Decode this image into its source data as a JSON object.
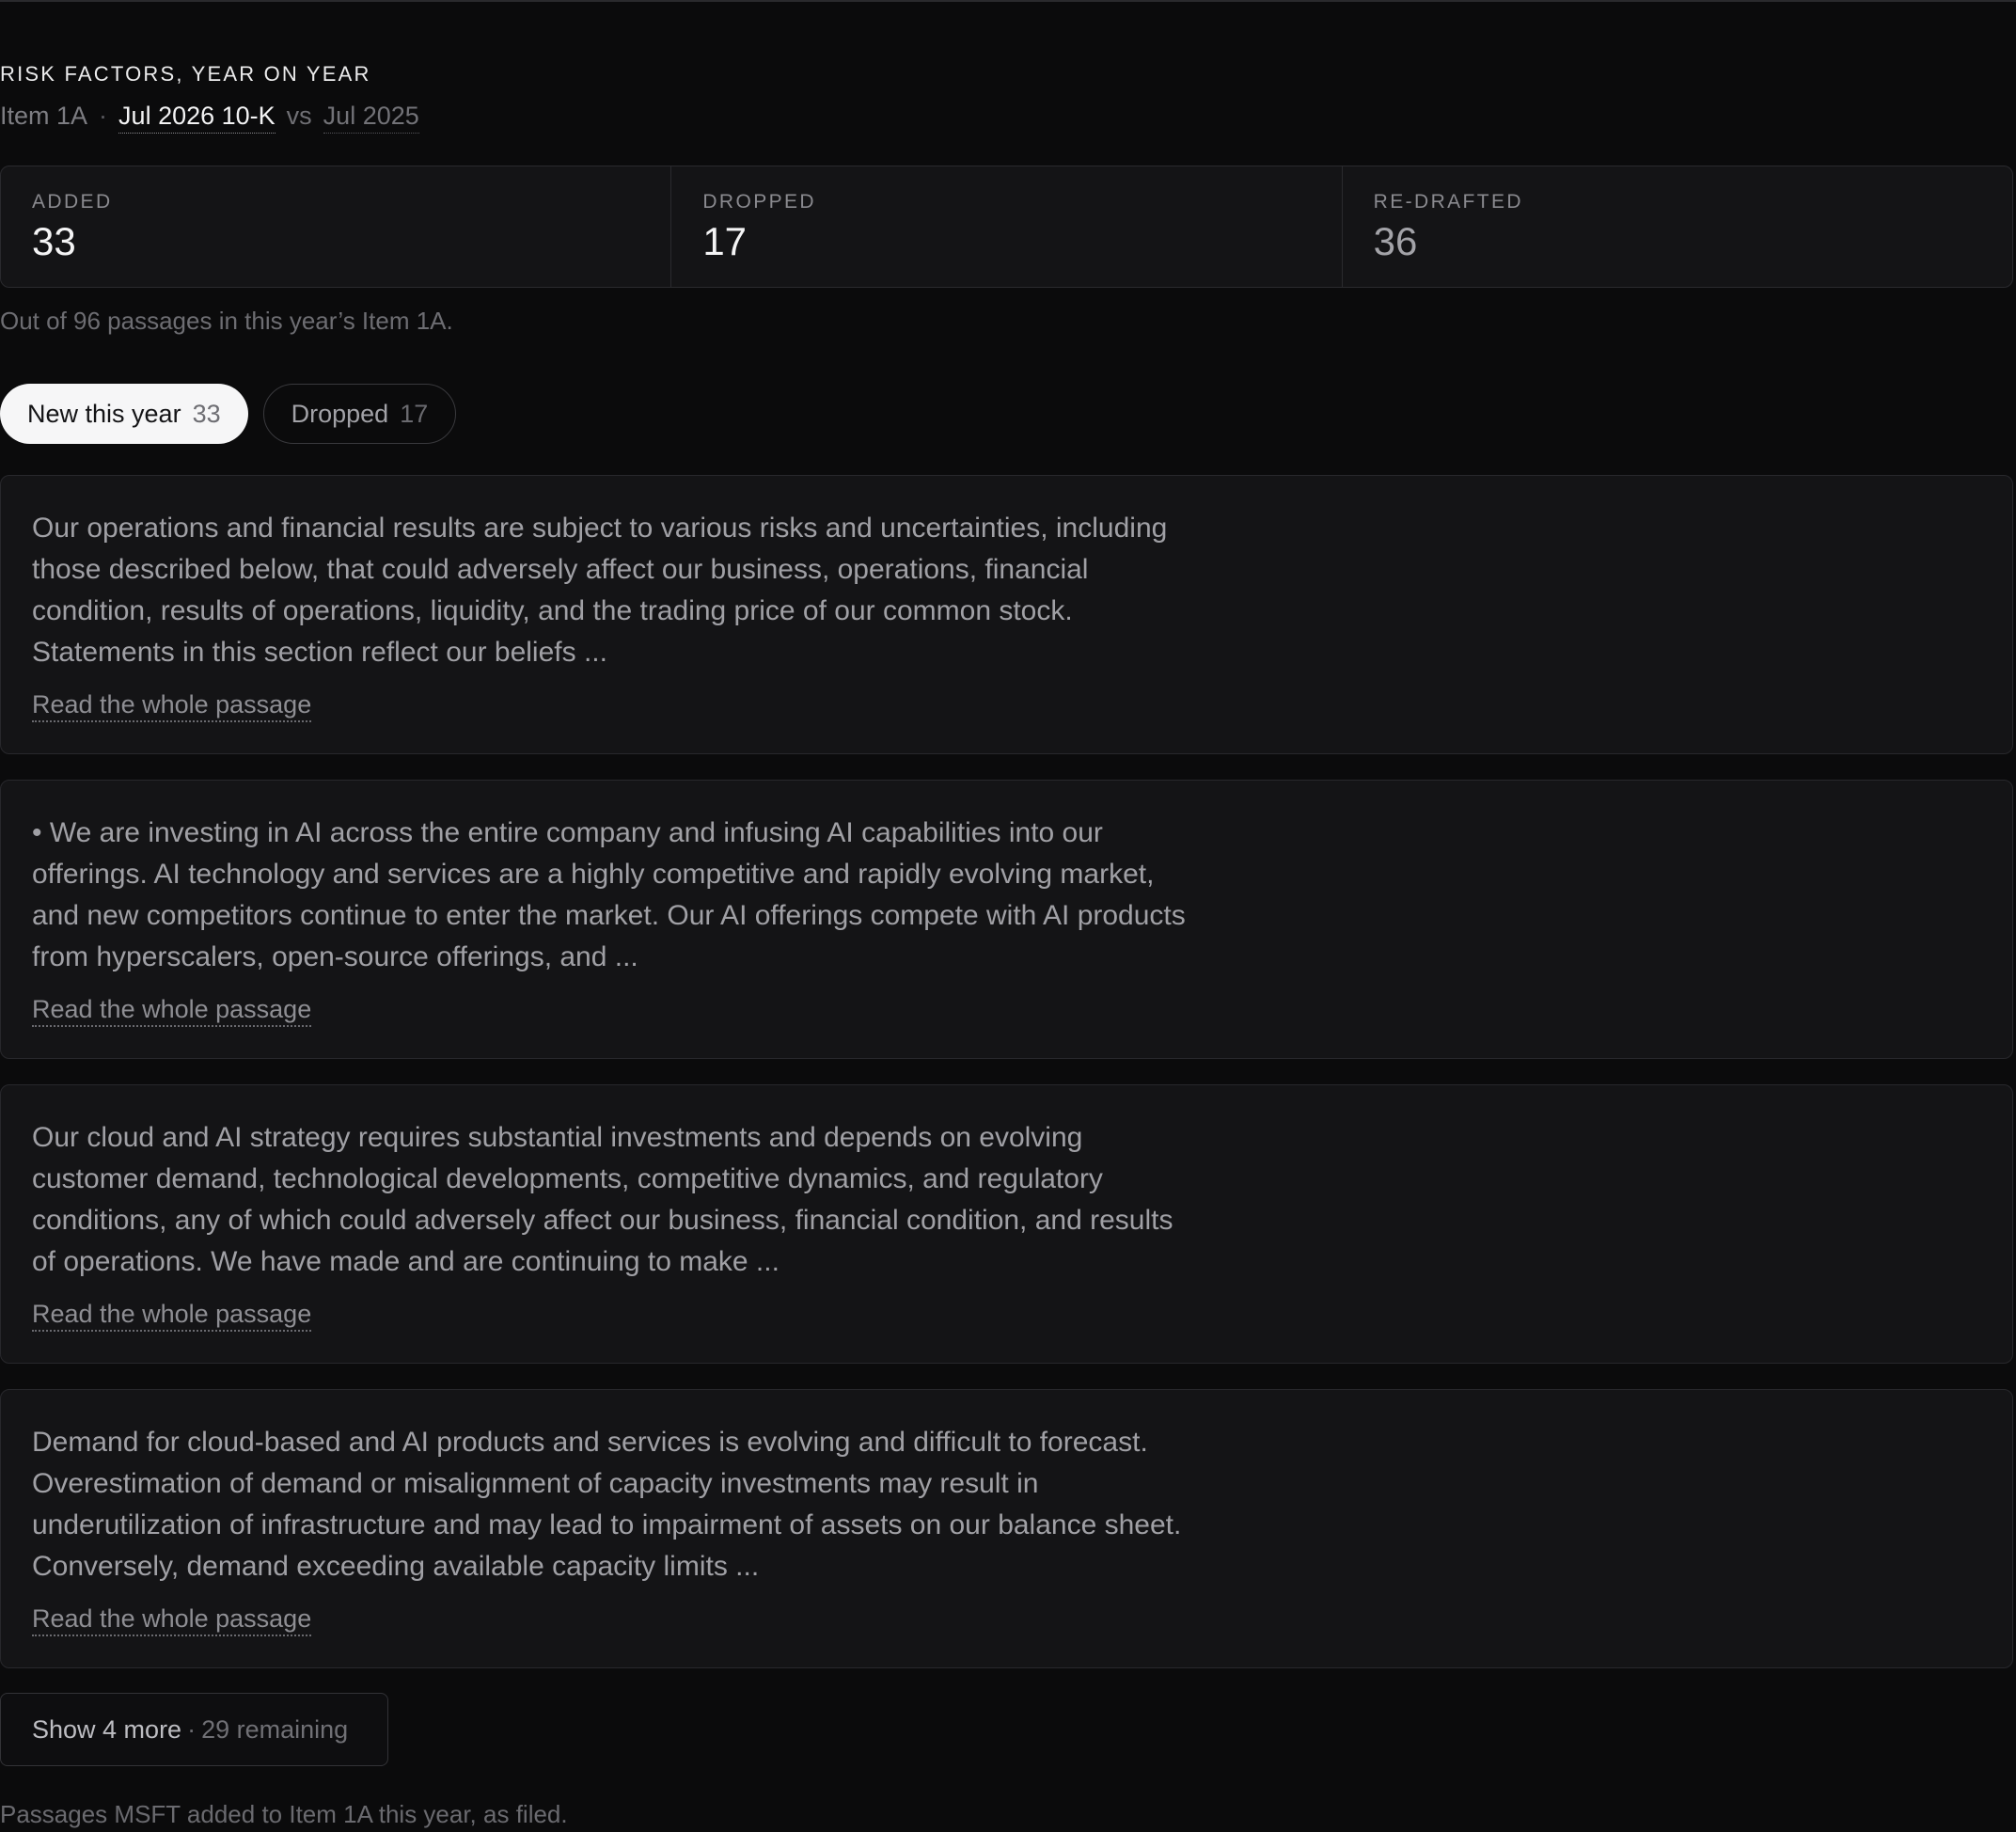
{
  "header": {
    "eyebrow": "RISK FACTORS, YEAR ON YEAR",
    "section": "Item 1A",
    "separator": "·",
    "current_filing": "Jul 2026 10-K",
    "vs": "vs",
    "previous_filing": "Jul 2025"
  },
  "stats": [
    {
      "label": "ADDED",
      "value": "33"
    },
    {
      "label": "DROPPED",
      "value": "17"
    },
    {
      "label": "RE-DRAFTED",
      "value": "36"
    }
  ],
  "summary_note": "Out of 96 passages in this year’s Item 1A.",
  "tabs": [
    {
      "label": "New this year",
      "count": "33",
      "active": true
    },
    {
      "label": "Dropped",
      "count": "17",
      "active": false
    }
  ],
  "passages": [
    {
      "text": "Our operations and financial results are subject to various risks and uncertainties, including those described below, that could adversely affect our business, operations, financial condition, results of operations, liquidity, and the trading price of our common stock. Statements in this section reflect our beliefs ...",
      "link": "Read the whole passage"
    },
    {
      "text": "• We are investing in AI across the entire company and infusing AI capabilities into our offerings. AI technology and services are a highly competitive and rapidly evolving market, and new competitors continue to enter the market. Our AI offerings compete with AI products from hyperscalers, open-source offerings, and ...",
      "link": "Read the whole passage"
    },
    {
      "text": "Our cloud and AI strategy requires substantial investments and depends on evolving customer demand, technological developments, competitive dynamics, and regulatory conditions, any of which could adversely affect our business, financial condition, and results of operations. We have made and are continuing to make ...",
      "link": "Read the whole passage"
    },
    {
      "text": "Demand for cloud-based and AI products and services is evolving and difficult to forecast. Overestimation of demand or misalignment of capacity investments may result in underutilization of infrastructure and may lead to impairment of assets on our balance sheet. Conversely, demand exceeding available capacity limits ...",
      "link": "Read the whole passage"
    }
  ],
  "more": {
    "label": "Show 4 more",
    "separator": "·",
    "remaining": "29 remaining"
  },
  "footer": "Passages MSFT added to Item 1A this year, as filed."
}
